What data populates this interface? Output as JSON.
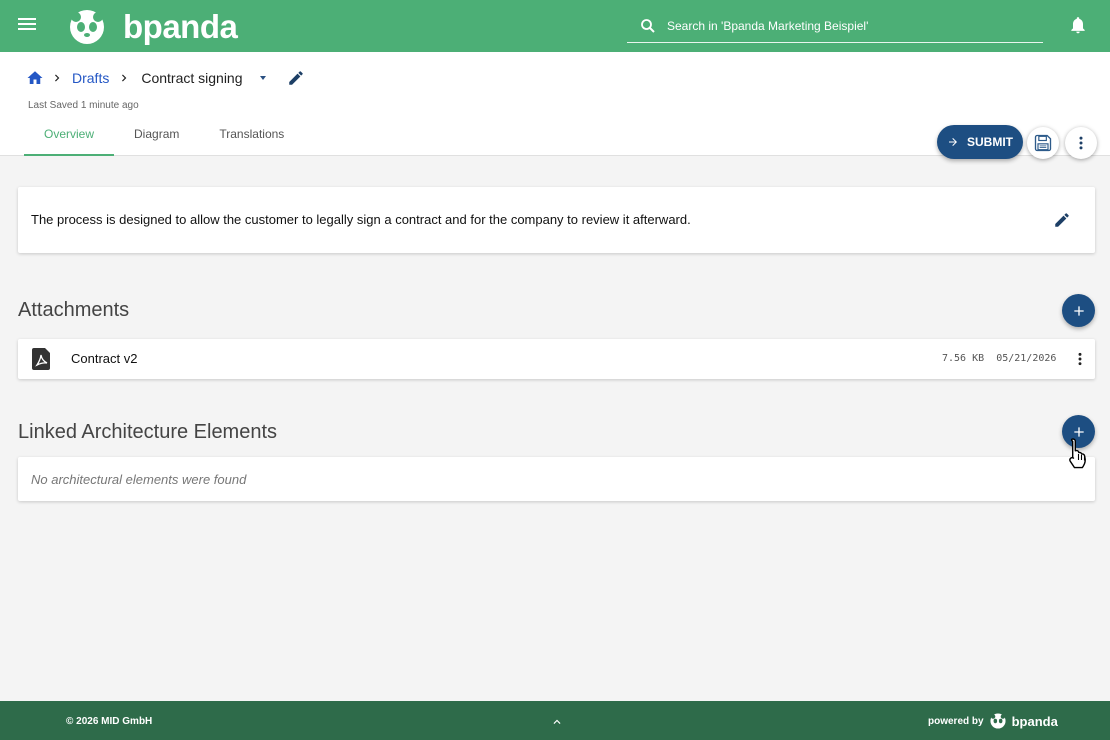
{
  "colors": {
    "topbar": "#4caf76",
    "footer": "#2e6b4a",
    "accent": "#4caf76",
    "primary_button": "#1d4e82",
    "link": "#2457c5"
  },
  "app": {
    "name": "bpanda",
    "menu_icon": "hamburger-menu-icon",
    "logo_icon": "panda-logo-icon",
    "notifications_icon": "bell-icon"
  },
  "search": {
    "icon": "search-icon",
    "placeholder": "Search in 'Bpanda Marketing Beispiel'"
  },
  "breadcrumb": {
    "home_icon": "home-icon",
    "items": [
      {
        "label": "Drafts"
      },
      {
        "label": "Contract signing"
      }
    ]
  },
  "last_saved": "Last Saved 1 minute ago",
  "tabs": [
    {
      "label": "Overview",
      "active": true
    },
    {
      "label": "Diagram",
      "active": false
    },
    {
      "label": "Translations",
      "active": false
    }
  ],
  "actions": {
    "submit_label": "SUBMIT",
    "save_icon": "floppy-disk-icon",
    "more_icon": "more-vert-icon"
  },
  "description": {
    "text": "The process is designed to allow the customer to legally sign a contract and for the company to review it afterward."
  },
  "attachments": {
    "title": "Attachments",
    "items": [
      {
        "name": "Contract v2",
        "size": "7.56 KB",
        "date": "05/21/2026",
        "icon": "pdf-icon"
      }
    ]
  },
  "linked": {
    "title": "Linked Architecture Elements",
    "empty": "No architectural elements were found"
  },
  "footer": {
    "copyright": "© 2026 MID GmbH",
    "powered_by": "powered by",
    "brand": "bpanda"
  }
}
